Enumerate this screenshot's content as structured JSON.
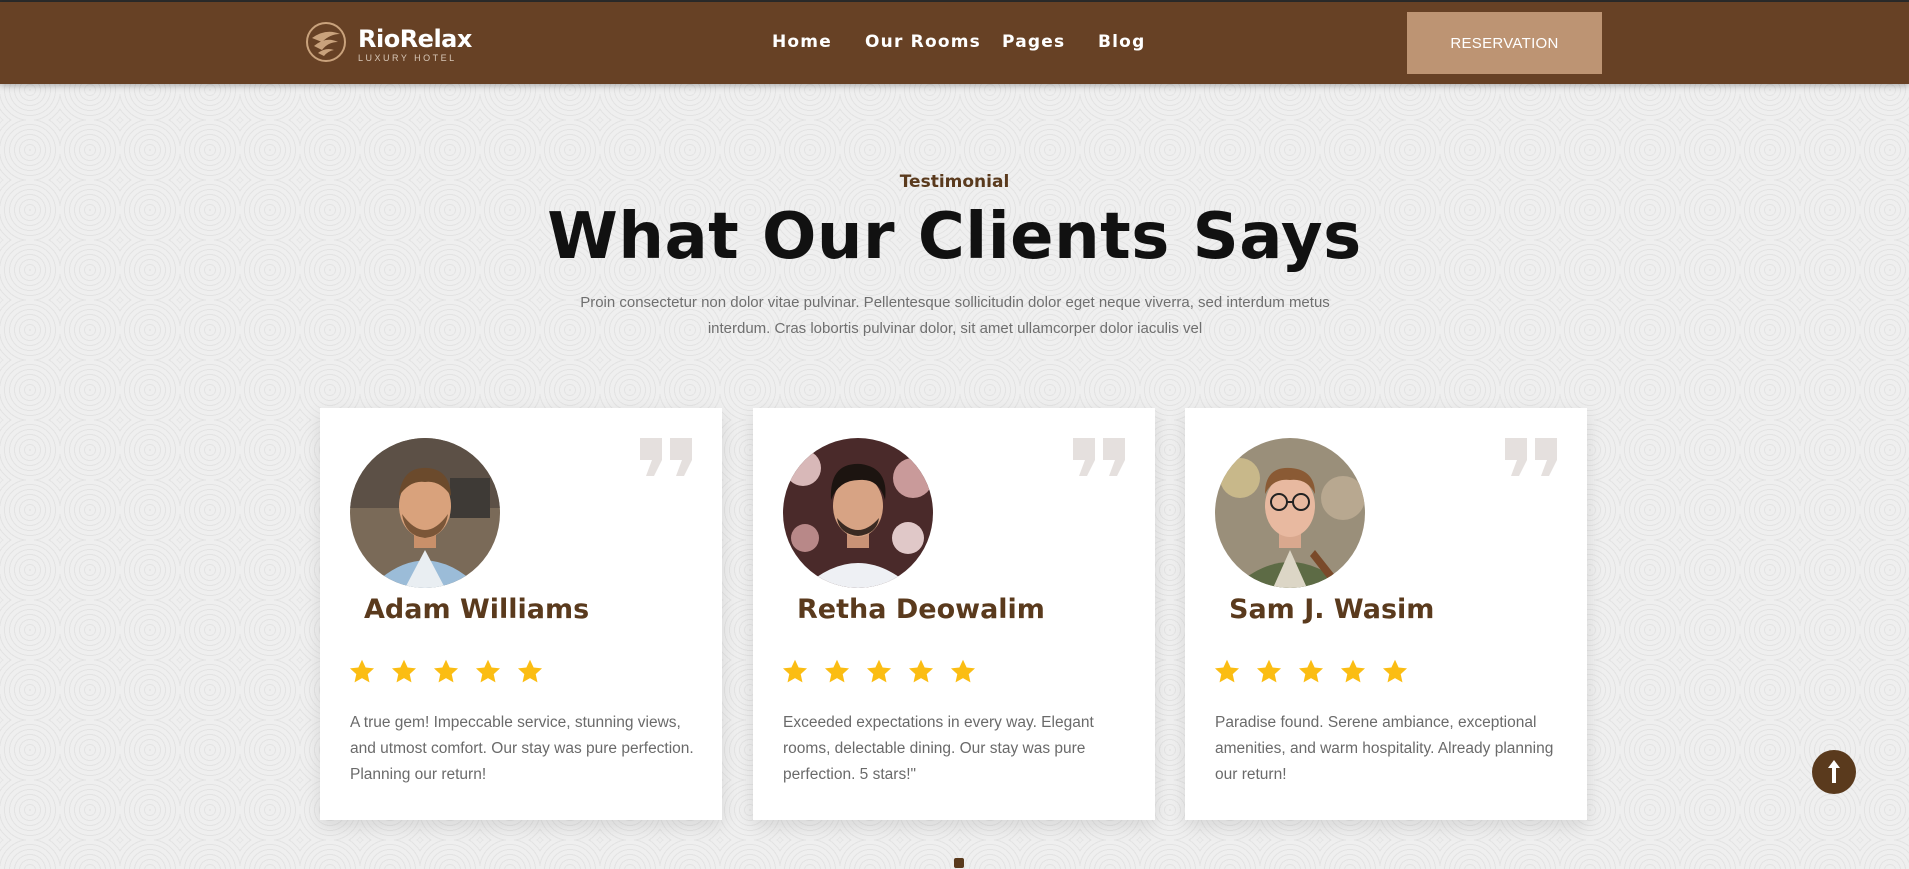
{
  "header": {
    "logo_name": "RioRelax",
    "logo_tagline": "LUXURY HOTEL",
    "nav": [
      "Home",
      "Our Rooms",
      "Pages",
      "Blog"
    ],
    "cta_label": "RESERVATION"
  },
  "testimonials": {
    "tag": "Testimonial",
    "title": "What Our Clients Says",
    "description": "Proin consectetur non dolor vitae pulvinar. Pellentesque sollicitudin dolor eget neque viverra, sed interdum metus interdum. Cras lobortis pulvinar dolor, sit amet ullamcorper dolor iaculis vel",
    "cards": [
      {
        "name": "Adam Williams",
        "rating": 5,
        "review": "A true gem! Impeccable service, stunning views, and utmost comfort. Our stay was pure perfection. Planning our return!"
      },
      {
        "name": "Retha Deowalim",
        "rating": 5,
        "review": "Exceeded expectations in every way. Elegant rooms, delectable dining. Our stay was pure perfection. 5 stars!\""
      },
      {
        "name": "Sam J. Wasim",
        "rating": 5,
        "review": "Paradise found. Serene ambiance, exceptional amenities, and warm hospitality. Already planning our return!"
      }
    ]
  },
  "icons": {
    "logo": "hotel-logo-icon",
    "quote": "quote-icon",
    "star": "star-icon",
    "scroll_top": "arrow-up-icon"
  },
  "colors": {
    "brand_brown": "#674125",
    "accent_tan": "#bd9473",
    "star_yellow": "#fbbd13",
    "name_brown": "#5a3a1d"
  }
}
